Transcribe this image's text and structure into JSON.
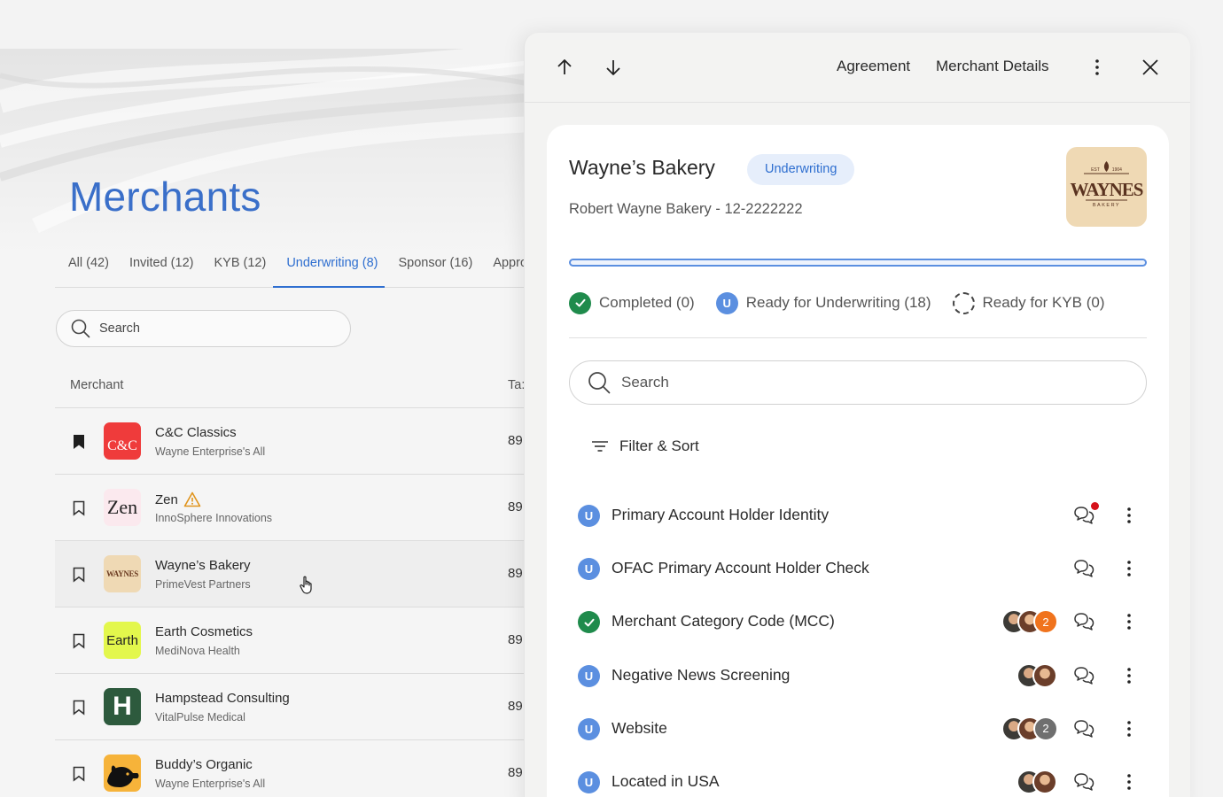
{
  "merchants_page": {
    "title": "Merchants",
    "tabs": [
      {
        "label": "All (42)"
      },
      {
        "label": "Invited (12)"
      },
      {
        "label": "KYB (12)"
      },
      {
        "label": "Underwriting (8)",
        "active": true
      },
      {
        "label": "Sponsor (16)"
      },
      {
        "label": "Approve"
      }
    ],
    "search": {
      "placeholder": "Search"
    },
    "columns": {
      "merchant": "Merchant",
      "tax": "Ta:"
    },
    "rows": [
      {
        "name": "C&C Classics",
        "sub": "Wayne Enterprise's All",
        "tax": "89",
        "logo_text": "C&C",
        "bookmarked": true
      },
      {
        "name": "Zen",
        "sub": "InnoSphere Innovations",
        "tax": "89",
        "logo_text": "Zen",
        "warning": true
      },
      {
        "name": "Wayne’s Bakery",
        "sub": "PrimeVest Partners",
        "tax": "89",
        "logo_text": "WAYNES"
      },
      {
        "name": "Earth Cosmetics",
        "sub": "MediNova Health",
        "tax": "89",
        "logo_text": "Earth"
      },
      {
        "name": "Hampstead Consulting",
        "sub": "VitalPulse Medical",
        "tax": "89",
        "logo_text": "H"
      },
      {
        "name": "Buddy’s Organic",
        "sub": "Wayne Enterprise's All",
        "tax": "89",
        "logo_text": ""
      }
    ]
  },
  "drawer": {
    "links": {
      "agreement": "Agreement",
      "merchant_details": "Merchant Details"
    },
    "merchant_name": "Wayne’s Bakery",
    "status": "Underwriting",
    "subtitle": "Robert Wayne Bakery - 12-2222222",
    "logo": {
      "est": "EST",
      "year": "1904",
      "wordmark": "WAYNES",
      "tagline": "BAKERY"
    },
    "status_summary": [
      {
        "label": "Completed (0)",
        "kind": "completed"
      },
      {
        "label": "Ready for Underwriting (18)",
        "kind": "underwriting",
        "badge": "U"
      },
      {
        "label": "Ready for KYB (0)",
        "kind": "kyb"
      }
    ],
    "search": {
      "placeholder": "Search"
    },
    "filter_label": "Filter & Sort",
    "checks": [
      {
        "label": "Primary Account Holder Identity",
        "status": "U",
        "unread": true,
        "avatars": []
      },
      {
        "label": "OFAC Primary Account Holder Check",
        "status": "U",
        "avatars": []
      },
      {
        "label": "Merchant Category Code (MCC)",
        "status": "done",
        "avatars": [
          "a",
          "b"
        ],
        "extra": "2",
        "extra_color": "#f0731d"
      },
      {
        "label": "Negative News Screening",
        "status": "U",
        "avatars": [
          "a",
          "b"
        ]
      },
      {
        "label": "Website",
        "status": "U",
        "avatars": [
          "a",
          "b"
        ],
        "extra": "2",
        "extra_color": "#6f6f6f"
      },
      {
        "label": "Located in USA",
        "status": "U",
        "avatars": [
          "a",
          "b"
        ]
      }
    ]
  },
  "colors": {
    "accent": "#2f6fd0",
    "title_blue": "#3a6fc9",
    "success": "#1f8b4c",
    "underwriting_badge": "#5b8fe0",
    "notification": "#d6121b"
  }
}
